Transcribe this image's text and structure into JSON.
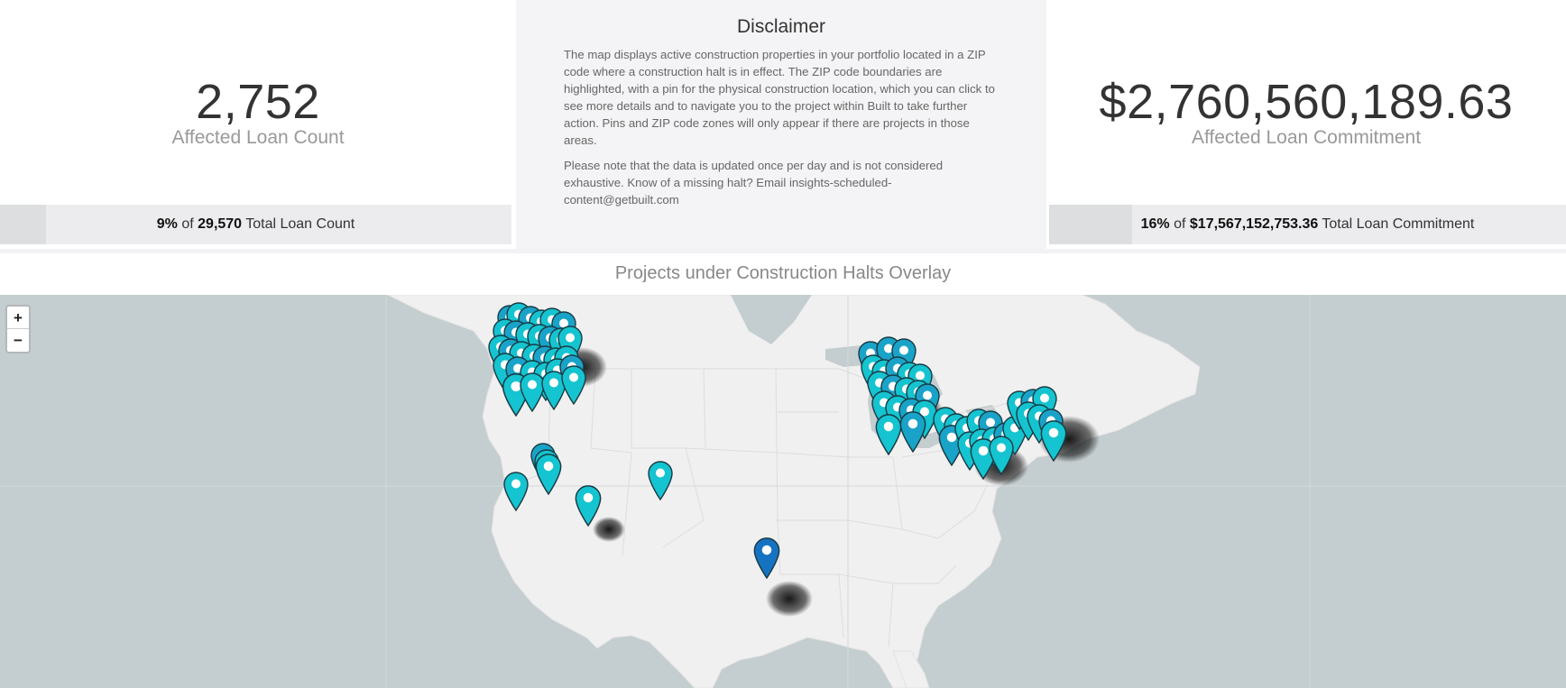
{
  "kpis": {
    "loan_count": {
      "value": "2,752",
      "label": "Affected Loan Count",
      "percent": "9%",
      "percent_value": 9,
      "of": "of",
      "total": "29,570",
      "total_label": "Total Loan Count"
    },
    "loan_commitment": {
      "value": "$2,760,560,189.63",
      "label": "Affected Loan Commitment",
      "percent": "16%",
      "percent_value": 16,
      "of": "of",
      "total": "$17,567,152,753.36",
      "total_label": "Total Loan Commitment"
    }
  },
  "disclaimer": {
    "title": "Disclaimer",
    "paragraph1": "The map displays active construction properties in your portfolio located in a ZIP code where a construction halt is in effect. The ZIP code boundaries are highlighted, with a pin for the physical construction location, which you can click to see more details and to navigate you to the project within Built to take further action. Pins and ZIP code zones will only appear if there are projects in those areas.",
    "paragraph2": "Please note that the data is updated once per day and is not considered exhaustive. Know of a missing halt? Email insights-scheduled-content@getbuilt.com"
  },
  "map": {
    "title": "Projects under Construction Halts Overlay",
    "zoom_in": "+",
    "zoom_out": "−",
    "colors": {
      "water": "#c4cdcf",
      "land": "#f0f0f0",
      "pin_cyan": "#14c4d0",
      "pin_teal": "#1aa3c8",
      "pin_blue": "#1673c2",
      "pin_outline": "#1a3b44"
    }
  }
}
